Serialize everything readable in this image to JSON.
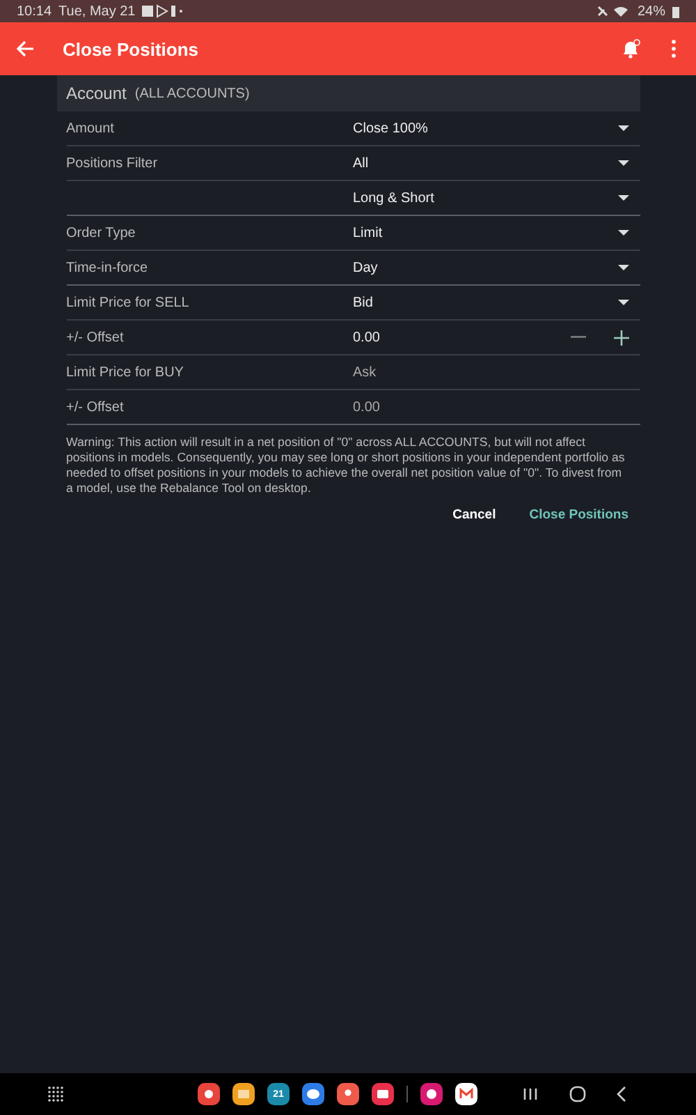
{
  "status_bar": {
    "time": "10:14",
    "date": "Tue, May 21",
    "battery": "24%"
  },
  "app_bar": {
    "title": "Close Positions",
    "notification_badge": true
  },
  "account": {
    "label": "Account",
    "value": "(ALL ACCOUNTS)"
  },
  "rows": [
    {
      "kind": "dropdown",
      "label": "Amount",
      "value": "Close 100%",
      "group_end": false
    },
    {
      "kind": "dropdown",
      "label": "Positions Filter",
      "value": "All",
      "group_end": false
    },
    {
      "kind": "dropdown",
      "value": "Long & Short",
      "group_end": true
    },
    {
      "kind": "dropdown",
      "label": "Order Type",
      "value": "Limit",
      "group_end": false
    },
    {
      "kind": "dropdown",
      "label": "Time-in-force",
      "value": "Day",
      "group_end": true
    },
    {
      "kind": "dropdown",
      "label": "Limit Price for SELL",
      "value": "Bid",
      "group_end": false
    },
    {
      "kind": "stepper",
      "label": "+/- Offset",
      "value": "0.00",
      "group_end": false
    },
    {
      "kind": "static",
      "label": "Limit Price for BUY",
      "value": "Ask",
      "group_end": false
    },
    {
      "kind": "static",
      "label": "+/- Offset",
      "value": "0.00",
      "group_end": true
    }
  ],
  "warning": "Warning: This action will result in a net position of \"0\" across ALL ACCOUNTS, but will not affect positions in models. Consequently, you may see long or short positions in your independent portfolio as needed to offset positions in your models to achieve the overall net position value of \"0\". To divest from a model, use the Rebalance Tool on desktop.",
  "buttons": [
    {
      "kind": "secondary",
      "label": "Cancel"
    },
    {
      "kind": "primary",
      "label": "Close Positions"
    }
  ],
  "dock": [
    {
      "kind": "browser",
      "color": "#e8453c"
    },
    {
      "kind": "folder",
      "color": "#f0a020"
    },
    {
      "kind": "calendar",
      "color": "#1a8aa8",
      "label": "21"
    },
    {
      "kind": "chat",
      "color": "#2e7be6"
    },
    {
      "kind": "contact",
      "color": "#ef5a4a"
    },
    {
      "kind": "camera",
      "color": "#e8304a"
    },
    {
      "kind": "divider"
    },
    {
      "kind": "flower",
      "color": "#d81b70"
    },
    {
      "kind": "mail",
      "color": "#ffffff"
    }
  ]
}
